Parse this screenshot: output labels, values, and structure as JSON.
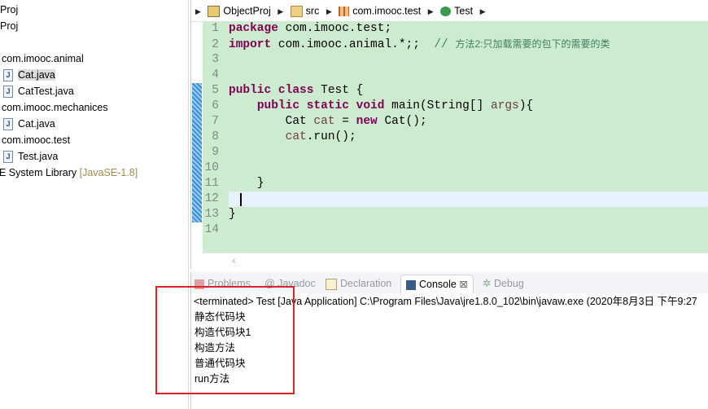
{
  "explorer": {
    "rows": [
      {
        "label": "Proj",
        "indent": 0
      },
      {
        "label": "Proj",
        "indent": 0
      },
      {
        "label": "com.imooc.animal",
        "type": "package"
      },
      {
        "label": "Cat.java",
        "type": "java",
        "selected": true
      },
      {
        "label": "CatTest.java",
        "type": "java"
      },
      {
        "label": "com.imooc.mechanices",
        "type": "package"
      },
      {
        "label": "Cat.java",
        "type": "java"
      },
      {
        "label": "com.imooc.test",
        "type": "package"
      },
      {
        "label": "Test.java",
        "type": "java"
      }
    ],
    "library": {
      "label": "E System Library",
      "version": "[JavaSE-1.8]"
    }
  },
  "breadcrumb": [
    "ObjectProj",
    "src",
    "com.imooc.test",
    "Test"
  ],
  "code": {
    "line_numbers": [
      "1",
      "2",
      "3",
      "4",
      "5",
      "6",
      "7",
      "8",
      "9",
      "10",
      "11",
      "12",
      "13",
      "14"
    ],
    "lines": [
      [
        [
          "k",
          "package"
        ],
        [
          "p",
          " com.imooc.test;"
        ]
      ],
      [
        [
          "k",
          "import"
        ],
        [
          "p",
          " com.imooc.animal.*;;  "
        ],
        [
          "c",
          "// "
        ],
        [
          "cm",
          "方法2:只加载需要的包下的需要的类"
        ]
      ],
      [],
      [],
      [
        [
          "k",
          "public"
        ],
        [
          "p",
          " "
        ],
        [
          "k",
          "class"
        ],
        [
          "p",
          " Test {"
        ]
      ],
      [
        [
          "p",
          "    "
        ],
        [
          "k",
          "public"
        ],
        [
          "p",
          " "
        ],
        [
          "k",
          "static"
        ],
        [
          "p",
          " "
        ],
        [
          "k",
          "void"
        ],
        [
          "p",
          " main(String[] "
        ],
        [
          "v",
          "args"
        ],
        [
          "p",
          "){"
        ]
      ],
      [
        [
          "p",
          "        Cat "
        ],
        [
          "v",
          "cat"
        ],
        [
          "p",
          " = "
        ],
        [
          "k",
          "new"
        ],
        [
          "p",
          " Cat();"
        ]
      ],
      [
        [
          "p",
          "        "
        ],
        [
          "v",
          "cat"
        ],
        [
          "p",
          ".run();"
        ]
      ],
      [],
      [],
      [
        [
          "p",
          "    }"
        ]
      ],
      [],
      [
        [
          "p",
          "}"
        ]
      ],
      []
    ],
    "current_line": 12
  },
  "console": {
    "tabs": [
      "Problems",
      "Javadoc",
      "Declaration",
      "Console",
      "Debug"
    ],
    "active_tab": "Console",
    "header": "<terminated> Test [Java Application] C:\\Program Files\\Java\\jre1.8.0_102\\bin\\javaw.exe (2020年8月3日 下午9:27",
    "output": [
      "静态代码块",
      "构造代码块1",
      "构造方法",
      "普通代码块",
      "run方法"
    ]
  },
  "colors": {
    "editor_bg": "#cdeccf",
    "keyword": "#7f0055",
    "comment": "#3f7f5f",
    "highlight_box": "#e0202a"
  }
}
